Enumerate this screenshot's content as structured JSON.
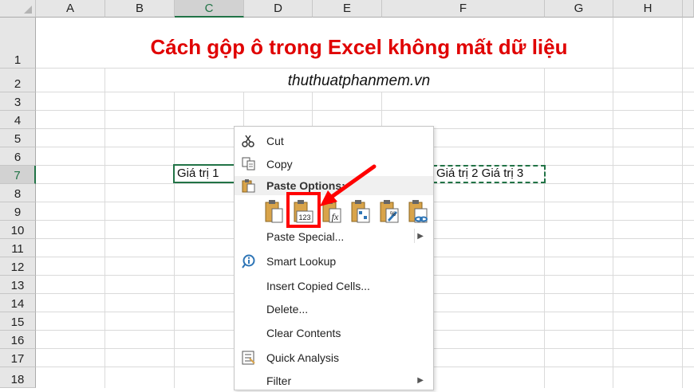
{
  "columns": [
    "A",
    "B",
    "C",
    "D",
    "E",
    "F",
    "G",
    "H"
  ],
  "rows": [
    "1",
    "2",
    "3",
    "4",
    "5",
    "6",
    "7",
    "8",
    "9",
    "10",
    "11",
    "12",
    "13",
    "14",
    "15",
    "16",
    "17",
    "18"
  ],
  "cells": {
    "title": "Cách gộp ô trong Excel không mất dữ liệu",
    "subtitle": "thuthuatphanmem.vn",
    "c7": "Giá trị 1",
    "f7": "Giá trị 2 Giá trị 3"
  },
  "menu": {
    "cut": "Cut",
    "copy": "Copy",
    "paste_options_header": "Paste Options:",
    "paste_special": "Paste Special...",
    "smart_lookup": "Smart Lookup",
    "insert_copied_cells": "Insert Copied Cells...",
    "delete": "Delete...",
    "clear_contents": "Clear Contents",
    "quick_analysis": "Quick Analysis",
    "filter": "Filter"
  },
  "paste_icons": [
    "paste-icon",
    "paste-values-icon",
    "paste-formulas-icon",
    "paste-transpose-icon",
    "paste-formatting-icon",
    "paste-link-icon"
  ],
  "paste_values_badge": "123",
  "colors": {
    "title_red": "#e00000",
    "excel_green": "#217346",
    "highlight_red": "#ff0000"
  }
}
